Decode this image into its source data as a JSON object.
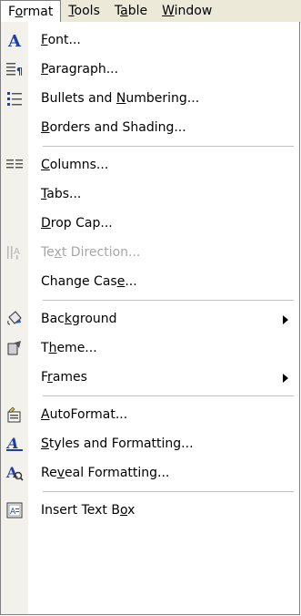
{
  "menubar": {
    "items": [
      {
        "pre": "F",
        "ul": "o",
        "post": "rmat"
      },
      {
        "pre": "",
        "ul": "T",
        "post": "ools"
      },
      {
        "pre": "T",
        "ul": "a",
        "post": "ble"
      },
      {
        "pre": "",
        "ul": "W",
        "post": "indow"
      }
    ]
  },
  "menu": {
    "items": [
      {
        "pre": "",
        "ul": "F",
        "post": "ont...",
        "icon": "font-icon"
      },
      {
        "pre": "",
        "ul": "P",
        "post": "aragraph...",
        "icon": "paragraph-icon"
      },
      {
        "pre": "Bullets and ",
        "ul": "N",
        "post": "umbering...",
        "icon": "bullets-icon"
      },
      {
        "pre": "",
        "ul": "B",
        "post": "orders and Shading...",
        "icon": ""
      },
      {
        "pre": "",
        "ul": "C",
        "post": "olumns...",
        "icon": "columns-icon"
      },
      {
        "pre": "",
        "ul": "T",
        "post": "abs...",
        "icon": ""
      },
      {
        "pre": "",
        "ul": "D",
        "post": "rop Cap...",
        "icon": ""
      },
      {
        "pre": "Te",
        "ul": "x",
        "post": "t Direction...",
        "icon": "text-direction-icon",
        "disabled": true
      },
      {
        "pre": "Change Cas",
        "ul": "e",
        "post": "...",
        "icon": ""
      },
      {
        "pre": "Bac",
        "ul": "k",
        "post": "ground",
        "icon": "background-icon",
        "submenu": true
      },
      {
        "pre": "T",
        "ul": "h",
        "post": "eme...",
        "icon": "theme-icon"
      },
      {
        "pre": "F",
        "ul": "r",
        "post": "ames",
        "icon": "",
        "submenu": true
      },
      {
        "pre": "",
        "ul": "A",
        "post": "utoFormat...",
        "icon": "autoformat-icon"
      },
      {
        "pre": "",
        "ul": "S",
        "post": "tyles and Formatting...",
        "icon": "styles-icon"
      },
      {
        "pre": "Re",
        "ul": "v",
        "post": "eal Formatting...",
        "icon": "reveal-formatting-icon"
      },
      {
        "pre": "Insert Text B",
        "ul": "o",
        "post": "x",
        "icon": "text-box-icon"
      }
    ]
  }
}
